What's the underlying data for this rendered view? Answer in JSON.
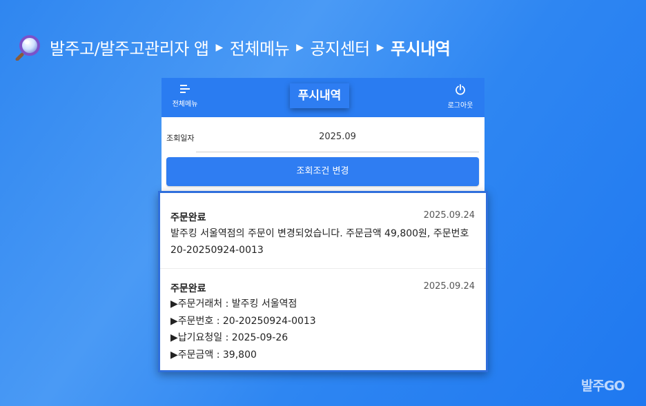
{
  "breadcrumb": {
    "icon": "magnifier-icon",
    "items": [
      "발주고/발주고관리자 앱",
      "전체메뉴",
      "공지센터"
    ],
    "current": "푸시내역",
    "separator": "▶"
  },
  "header": {
    "menu_icon": "menu-icon",
    "menu_label": "전체메뉴",
    "title": "푸시내역",
    "logout_icon": "power-icon",
    "logout_label": "로그아웃"
  },
  "query": {
    "label": "조회일자",
    "value": "2025.09",
    "button_label": "조회조건 변경"
  },
  "notifications": [
    {
      "title": "주문완료",
      "date": "2025.09.24",
      "lines": [
        "발주킹 서울역점의 주문이 변경되었습니다. 주문금액 49,800원, 주문번호",
        "20-20250924-0013"
      ]
    },
    {
      "title": "주문완료",
      "date": "2025.09.24",
      "lines": [
        "▶주문거래처 : 발주킹 서울역점",
        "▶주문번호 : 20-20250924-0013",
        "▶납기요청일 : 2025-09-26",
        "▶주문금액 : 39,800"
      ]
    }
  ],
  "brand": {
    "logo_text": "발주GO"
  },
  "colors": {
    "background": "#2f86f0",
    "header": "#2a7cf1",
    "button": "#2f7df2",
    "panel_border": "#2f6fdc"
  }
}
